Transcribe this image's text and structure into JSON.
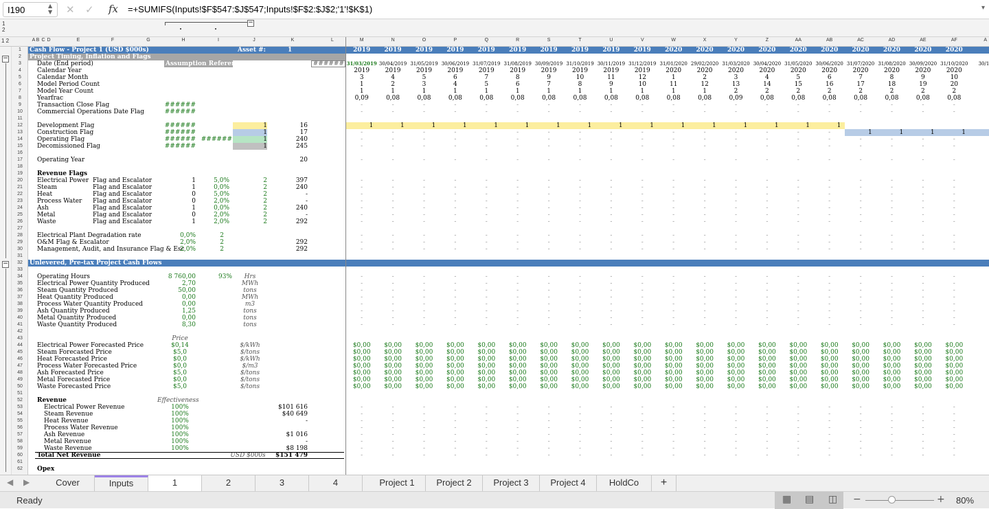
{
  "formula_bar": {
    "cell_ref": "I190",
    "formula": "=+SUMIFS(Inputs!$F$547:$J$547;Inputs!$F$2:$J$2;'1'!$K$1)"
  },
  "outline_levels": [
    "1",
    "2"
  ],
  "column_letters": [
    "A",
    "B",
    "C",
    "D",
    "E",
    "F",
    "G",
    "H",
    "I",
    "J",
    "K",
    "L",
    "M",
    "N",
    "O",
    "P",
    "Q",
    "R",
    "S",
    "T",
    "U",
    "V",
    "W",
    "X",
    "Y",
    "Z",
    "AA",
    "AB",
    "AC",
    "AD",
    "AE",
    "AF",
    "A"
  ],
  "header_row": {
    "title": "Cash Flow - Project 1 (USD $000s)",
    "asset_label": "Asset #:",
    "asset_value": "1",
    "years": [
      "2019",
      "2019",
      "2019",
      "2019",
      "2019",
      "2019",
      "2019",
      "2019",
      "2019",
      "2019",
      "2020",
      "2020",
      "2020",
      "2020",
      "2020",
      "2020",
      "2020",
      "2020",
      "2020",
      "2020"
    ]
  },
  "section_timing": {
    "title": "Project Timing, Inflation and Flags",
    "assumption_ref": "Assumption Reference",
    "hash": "######"
  },
  "dates": [
    "31/03/2019",
    "30/04/2019",
    "31/05/2019",
    "30/06/2019",
    "31/07/2019",
    "31/08/2019",
    "30/09/2019",
    "31/10/2019",
    "30/11/2019",
    "31/12/2019",
    "31/01/2020",
    "29/02/2020",
    "31/03/2020",
    "30/04/2020",
    "31/05/2020",
    "30/06/2020",
    "31/07/2020",
    "31/08/2020",
    "30/09/2020",
    "31/10/2020",
    "30/11"
  ],
  "calendar_year": [
    "2019",
    "2019",
    "2019",
    "2019",
    "2019",
    "2019",
    "2019",
    "2019",
    "2019",
    "2019",
    "2020",
    "2020",
    "2020",
    "2020",
    "2020",
    "2020",
    "2020",
    "2020",
    "2020",
    "2020"
  ],
  "calendar_month": [
    "3",
    "4",
    "5",
    "6",
    "7",
    "8",
    "9",
    "10",
    "11",
    "12",
    "1",
    "2",
    "3",
    "4",
    "5",
    "6",
    "7",
    "8",
    "9",
    "10"
  ],
  "model_period": [
    "1",
    "2",
    "3",
    "4",
    "5",
    "6",
    "7",
    "8",
    "9",
    "10",
    "11",
    "12",
    "13",
    "14",
    "15",
    "16",
    "17",
    "18",
    "19",
    "20"
  ],
  "model_year": [
    "1",
    "1",
    "1",
    "1",
    "1",
    "1",
    "1",
    "1",
    "1",
    "1",
    "1",
    "1",
    "2",
    "2",
    "2",
    "2",
    "2",
    "2",
    "2",
    "2"
  ],
  "yearfrac": [
    "0,09",
    "0,08",
    "0,08",
    "0,08",
    "0,08",
    "0,08",
    "0,08",
    "0,08",
    "0,08",
    "0,08",
    "0,08",
    "0,08",
    "0,09",
    "0,08",
    "0,08",
    "0,08",
    "0,08",
    "0,08",
    "0,08",
    "0,08"
  ],
  "labels": {
    "r3": "Date (End period)",
    "r4": "Calendar Year",
    "r5": "Calendar Month",
    "r6": "Model Period Count",
    "r7": "Model Year Count",
    "r8": "Yearfrac",
    "r9": "Transaction Close Flag",
    "r10": "Commercial Operations Date Flag",
    "r12": "Development Flag",
    "r13": "Construction Flag",
    "r14": "Operating Flag",
    "r15": "Decomissioned Flag",
    "r17": "Operating Year",
    "r19": "Revenue Flags",
    "r28": "Electrical Plant Degradation rate",
    "r29": "O&M Flag & Escalator",
    "r30": "Management, Audit, and Insurance Flag & Esc"
  },
  "flags": {
    "i12": "1",
    "i13": "1",
    "i14": "1",
    "i15": "1",
    "k12": "16",
    "k13": "17",
    "k14": "240",
    "k15": "245",
    "k17": "20"
  },
  "revenue_flags": [
    {
      "name": "Electrical Power",
      "desc": "Flag and Escalator",
      "h": "1",
      "i": "5,0%",
      "j": "2",
      "k": "397"
    },
    {
      "name": "Steam",
      "desc": "Flag and Escalator",
      "h": "1",
      "i": "0,0%",
      "j": "2",
      "k": "240"
    },
    {
      "name": "Heat",
      "desc": "Flag and Escalator",
      "h": "0",
      "i": "5,0%",
      "j": "2",
      "k": "-"
    },
    {
      "name": "Process Water",
      "desc": "Flag and Escalator",
      "h": "0",
      "i": "2,0%",
      "j": "2",
      "k": "-"
    },
    {
      "name": "Ash",
      "desc": "Flag and Escalator",
      "h": "1",
      "i": "0,0%",
      "j": "2",
      "k": "240"
    },
    {
      "name": "Metal",
      "desc": "Flag and Escalator",
      "h": "0",
      "i": "2,0%",
      "j": "2",
      "k": "-"
    },
    {
      "name": "Waste",
      "desc": "Flag and Escalator",
      "h": "1",
      "i": "2,0%",
      "j": "2",
      "k": "292"
    }
  ],
  "esc": {
    "h28": "0,0%",
    "i28": "2",
    "h29": "2,0%",
    "i29": "2",
    "k29": "292",
    "h30": "2,0%",
    "i30": "2",
    "k30": "292"
  },
  "section_cf": {
    "title": "Unlevered, Pre-tax Project Cash Flows"
  },
  "production": [
    {
      "name": "Operating Hours",
      "h": "8 760,00",
      "i": "93%",
      "j": "Hrs"
    },
    {
      "name": "Electrical Power Quantity Produced",
      "h": "2,70",
      "j": "MWh"
    },
    {
      "name": "Steam Quantity Produced",
      "h": "50,00",
      "j": "tons"
    },
    {
      "name": "Heat Quantity Produced",
      "h": "0,00",
      "j": "MWh"
    },
    {
      "name": "Process Water Quantity Produced",
      "h": "0,00",
      "j": "m3"
    },
    {
      "name": "Ash Quantity Produced",
      "h": "1,25",
      "j": "tons"
    },
    {
      "name": "Metal Quantity Produced",
      "h": "0,00",
      "j": "tons"
    },
    {
      "name": "Waste Quantity Produced",
      "h": "8,30",
      "j": "tons"
    }
  ],
  "price_header": "Price",
  "prices": [
    {
      "name": "Electrical Power Forecasted Price",
      "h": "$0,14",
      "j": "$/kWh"
    },
    {
      "name": "Steam  Forecasted Price",
      "h": "$5,0",
      "j": "$/tons"
    },
    {
      "name": "Heat Forecasted Price",
      "h": "$0,0",
      "j": "$/kWh"
    },
    {
      "name": "Process Water Forecasted Price",
      "h": "$0,0",
      "j": "$/m3"
    },
    {
      "name": "Ash Forecasted Price",
      "h": "$5,0",
      "j": "$/tons"
    },
    {
      "name": "Metal Forecasted Price",
      "h": "$0,0",
      "j": "$/tons"
    },
    {
      "name": "Waste Forecasted Price",
      "h": "$5,0",
      "j": "$/tons"
    }
  ],
  "price_cell": "$0,00",
  "revenue_title": "Revenue",
  "eff_header": "Effectiveness",
  "revenues": [
    {
      "name": "Electrical Power Revenue",
      "h": "100%",
      "k": "$101 616"
    },
    {
      "name": "Steam  Revenue",
      "h": "100%",
      "k": "$40 649"
    },
    {
      "name": "Heat Revenue",
      "h": "100%",
      "k": "-"
    },
    {
      "name": "Process Water Revenue",
      "h": "100%",
      "k": ""
    },
    {
      "name": "Ash Revenue",
      "h": "100%",
      "k": "$1 016"
    },
    {
      "name": "Metal Revenue",
      "h": "100%",
      "k": "-"
    },
    {
      "name": "Waste Revenue",
      "h": "100%",
      "k": "$8 198"
    }
  ],
  "total": {
    "name": "Total Net Revenue",
    "unit": "USD $000s",
    "k": "$151 479"
  },
  "opex": "Opex",
  "dash": "-",
  "sheet_tabs": [
    "Cover",
    "Inputs",
    "1",
    "2",
    "3",
    "4",
    "Project 1",
    "Project 2",
    "Project 3",
    "Project 4",
    "HoldCo",
    "+"
  ],
  "status": {
    "ready": "Ready",
    "zoom": "80%"
  },
  "colors": {
    "header_blue": "#4a7ebb",
    "yellow": "#fcee9e",
    "blue_flag": "#b7cce6",
    "green_flag": "#b6e5c4",
    "gray_flag": "#c0c0c0",
    "tab_accent": "#9d82e6",
    "green_text": "#1b7a1b"
  }
}
